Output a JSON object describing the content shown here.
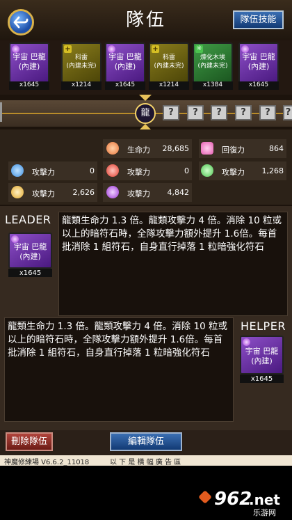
{
  "header": {
    "title": "隊伍",
    "skill_button": "隊伍技能"
  },
  "team": [
    {
      "name": "宇宙 巴龍\n(內建)",
      "count": "x1645",
      "style": "purple",
      "attr": "dark"
    },
    {
      "name": "科雷\n(內建未完)",
      "count": "x1214",
      "style": "olive",
      "attr": "plus"
    },
    {
      "name": "宇宙 巴龍\n(內建)",
      "count": "x1645",
      "style": "purple",
      "attr": "dark"
    },
    {
      "name": "科雷\n(內建未完)",
      "count": "x1214",
      "style": "olive",
      "attr": "plus"
    },
    {
      "name": "煉化木埃\n(內建未完)",
      "count": "x1384",
      "style": "green",
      "attr": "wood"
    },
    {
      "name": "宇宙 巴龍\n(內建)",
      "count": "x1645",
      "style": "purple",
      "attr": "dark"
    }
  ],
  "race_badge": "龍",
  "awakenings": [
    "?",
    "?",
    "?",
    "?",
    "?"
  ],
  "stats": {
    "hp_label": "生命力",
    "hp_value": "28,685",
    "rcv_label": "回復力",
    "rcv_value": "864",
    "water_atk_label": "攻擊力",
    "water_atk_value": "0",
    "fire_atk_label": "攻擊力",
    "fire_atk_value": "0",
    "wood_atk_label": "攻擊力",
    "wood_atk_value": "1,268",
    "light_atk_label": "攻擊力",
    "light_atk_value": "2,626",
    "dark_atk_label": "攻擊力",
    "dark_atk_value": "4,842"
  },
  "leader": {
    "label": "LEADER",
    "card_name": "宇宙 巴龍\n(內建)",
    "card_count": "x1645",
    "skill_text": "龍類生命力 1.3 倍。龍類攻擊力 4 倍。消除 10 粒或以上的暗符石時，全隊攻擊力額外提升 1.6倍。每首批消除 1 組符石，自身直行掉落 1 粒暗強化符石"
  },
  "helper": {
    "label": "HELPER",
    "card_name": "宇宙 巴龍\n(內建)",
    "card_count": "x1645",
    "skill_text": "龍類生命力 1.3 倍。龍類攻擊力 4 倍。消除 10 粒或以上的暗符石時，全隊攻擊力額外提升 1.6倍。每首批消除 1 組符石，自身直行掉落 1 粒暗強化符石"
  },
  "buttons": {
    "delete": "刪除隊伍",
    "edit": "編輯隊伍"
  },
  "status_bar": {
    "version": "神魔修練場 V6.6.2_11018",
    "ad_notice": "以 下 是 橫 幅 廣 告 區"
  },
  "watermark": {
    "brand": "962",
    "domain": ".net",
    "subtitle": "乐游网"
  },
  "colors": {
    "dark_attr": "#9b33d6",
    "water_attr": "#3e8fe0",
    "fire_attr": "#e03a2c",
    "wood_attr": "#4cc24f",
    "light_attr": "#e0a72a",
    "hp_icon": "#e8743a",
    "rcv_icon": "#e55bb0",
    "accent_gold": "#d9b24a"
  }
}
